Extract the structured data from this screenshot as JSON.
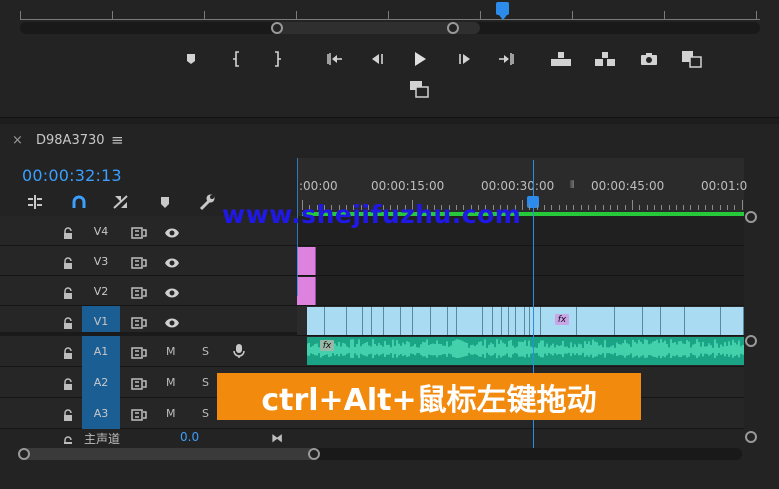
{
  "monitor": {
    "transport": [
      {
        "name": "add-marker-icon"
      },
      {
        "name": "mark-in-icon"
      },
      {
        "name": "mark-out-icon"
      },
      {
        "name": "go-to-in-icon"
      },
      {
        "name": "step-back-icon"
      },
      {
        "name": "play-icon"
      },
      {
        "name": "step-forward-icon"
      },
      {
        "name": "go-to-out-icon"
      },
      {
        "name": "lift-icon"
      },
      {
        "name": "extract-icon"
      },
      {
        "name": "export-frame-icon"
      },
      {
        "name": "comparison-view-icon"
      }
    ]
  },
  "timeline": {
    "close_label": "×",
    "sequence_name": "D98A3730",
    "menu_label": "≡",
    "timecode": "00:00:32:13",
    "ruler_labels": [
      ":00:00",
      "00:00:15:00",
      "00:00:30:00",
      "00:00:45:00",
      "00:01:0"
    ],
    "tracks": {
      "video": [
        "V4",
        "V3",
        "V2",
        "V1"
      ],
      "audio": [
        "A1",
        "A2",
        "A3"
      ],
      "mute_label": "M",
      "solo_label": "S"
    },
    "master_label": "主声道",
    "master_value": "0.0",
    "fx_label": "fx"
  },
  "overlay": {
    "watermark": "www.shejifuzhu.com",
    "caption": "ctrl+Alt+鼠标左键拖动"
  },
  "colors": {
    "accent_blue": "#2d8ceb",
    "timecode_blue": "#3a9fff",
    "video_clip": "#a9dcf2",
    "pink_clip": "#de82df",
    "audio_clip": "#1aa384",
    "work_area": "#26c93a",
    "caption_bg": "#f18a0d",
    "watermark": "#2018e5"
  }
}
